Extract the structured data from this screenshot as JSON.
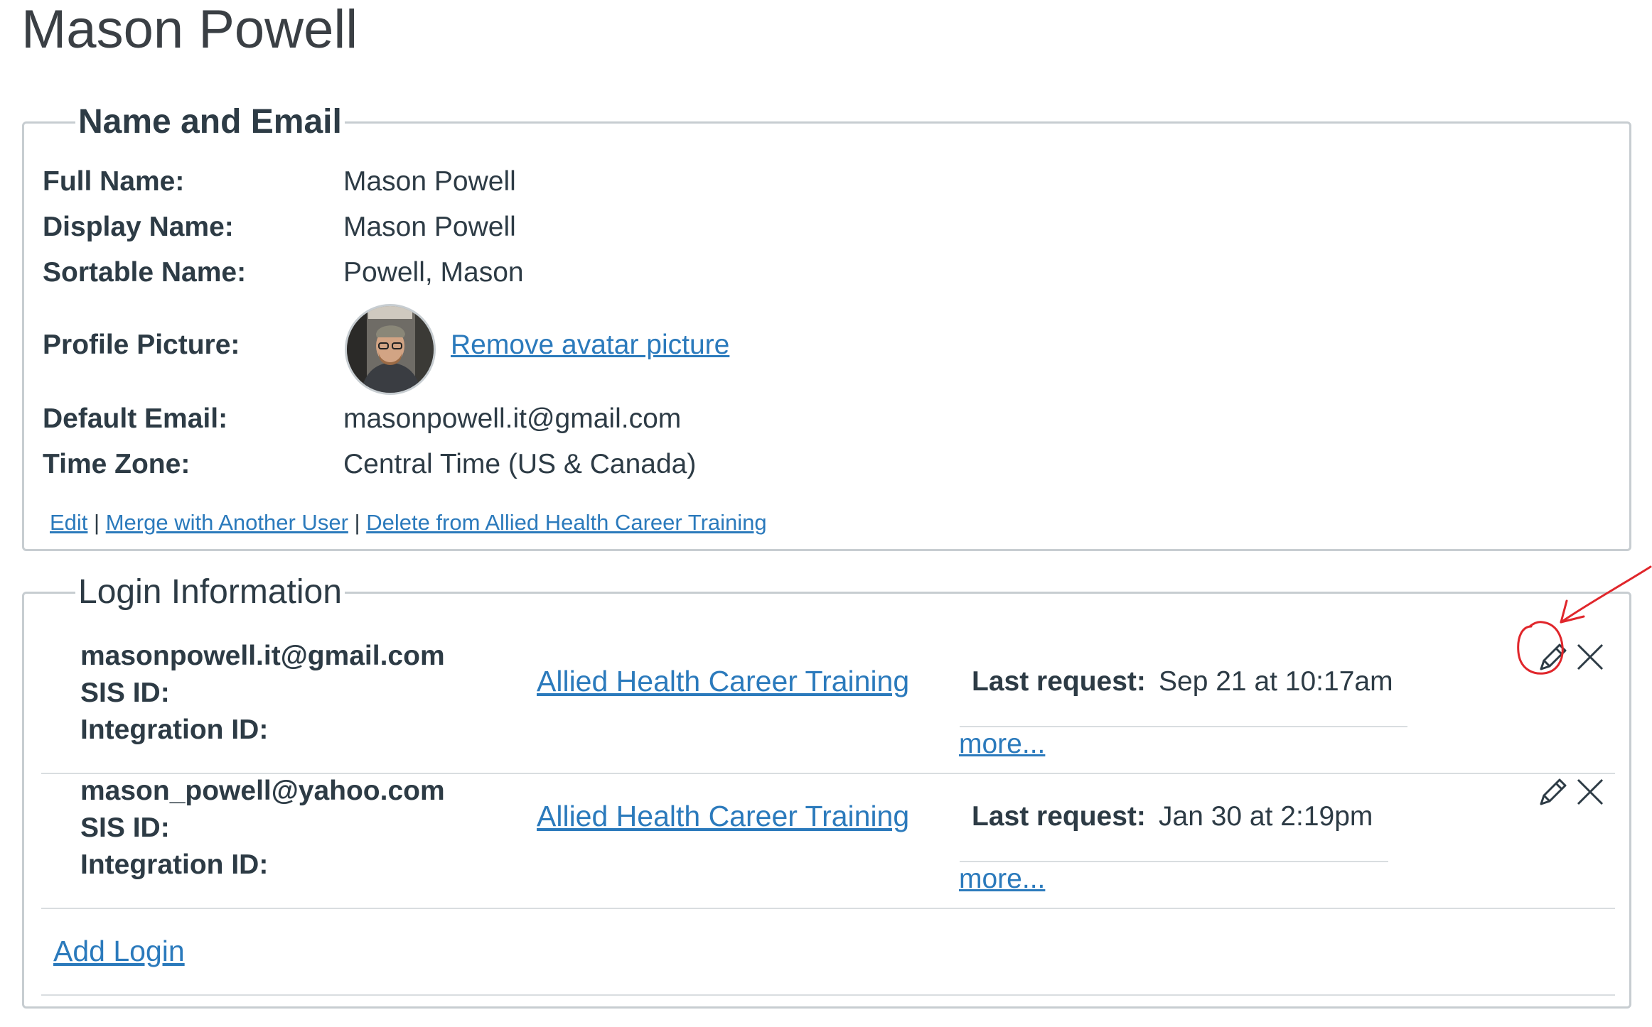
{
  "page": {
    "title": "Mason Powell"
  },
  "name_email": {
    "legend": "Name and Email",
    "rows": [
      {
        "label": "Full Name:",
        "value": "Mason Powell"
      },
      {
        "label": "Display Name:",
        "value": "Mason Powell"
      },
      {
        "label": "Sortable Name:",
        "value": "Powell, Mason"
      },
      {
        "label": "Profile Picture:",
        "link": "Remove avatar picture"
      },
      {
        "label": "Default Email:",
        "value": "masonpowell.it@gmail.com"
      },
      {
        "label": "Time Zone:",
        "value": "Central Time (US & Canada)"
      }
    ],
    "actions": {
      "edit": "Edit",
      "merge": "Merge with Another User",
      "delete": "Delete from Allied Health Career Training",
      "separator": "|"
    }
  },
  "login_info": {
    "legend": "Login Information",
    "sis_label": "SIS ID:",
    "integration_label": "Integration ID:",
    "last_request_label": "Last request:",
    "more_label": "more...",
    "logins": [
      {
        "login": "masonpowell.it@gmail.com",
        "account": "Allied Health Career Training",
        "last_request": "Sep 21 at 10:17am",
        "edit_icon": "pencil-icon",
        "delete_icon": "close-icon"
      },
      {
        "login": "mason_powell@yahoo.com",
        "account": "Allied Health Career Training",
        "last_request": "Jan 30 at 2:19pm",
        "edit_icon": "pencil-icon",
        "delete_icon": "close-icon"
      }
    ],
    "add_login": "Add Login"
  },
  "annotation": {
    "color": "#e0262b"
  },
  "colors": {
    "link": "#2b7abc",
    "text": "#2d3b45",
    "border": "#c7cdd1"
  }
}
